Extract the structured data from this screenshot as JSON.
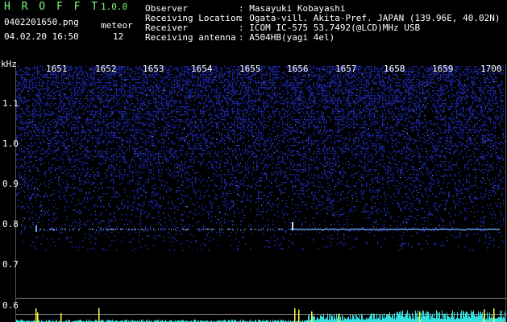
{
  "header": {
    "app_name": "H R O F F T",
    "version": "1.0.0",
    "filename": "0402201650.png",
    "datetime": "04.02.20 16:50",
    "meteor_label": "meteor",
    "meteor_count": "12",
    "info": [
      {
        "label": "Observer",
        "value": ": Masayuki Kobayashi"
      },
      {
        "label": "Receiving Location",
        "value": ": Ogata-vill. Akita-Pref. JAPAN (139.96E, 40.02N)"
      },
      {
        "label": "Receiver",
        "value": ": ICOM IC-575 53.7492(@LCD)MHz USB"
      },
      {
        "label": "Receiving antenna",
        "value": ": A504HB(yagi 4el)"
      }
    ]
  },
  "spectrogram": {
    "y_unit": "kHz",
    "y_ticks": [
      "1.1",
      "1.0",
      "0.9",
      "0.8",
      "0.7",
      "0.6"
    ],
    "x_ticks": [
      "1651",
      "1652",
      "1653",
      "1654",
      "1655",
      "1656",
      "1657",
      "1658",
      "1659",
      "1700"
    ],
    "colors": {
      "background": "#000000",
      "noise": "#2a3cff",
      "trace": "#6fa0ff",
      "spectrum": "#33e0e0",
      "spike": "#ffff40",
      "grid": "#808080"
    }
  }
}
